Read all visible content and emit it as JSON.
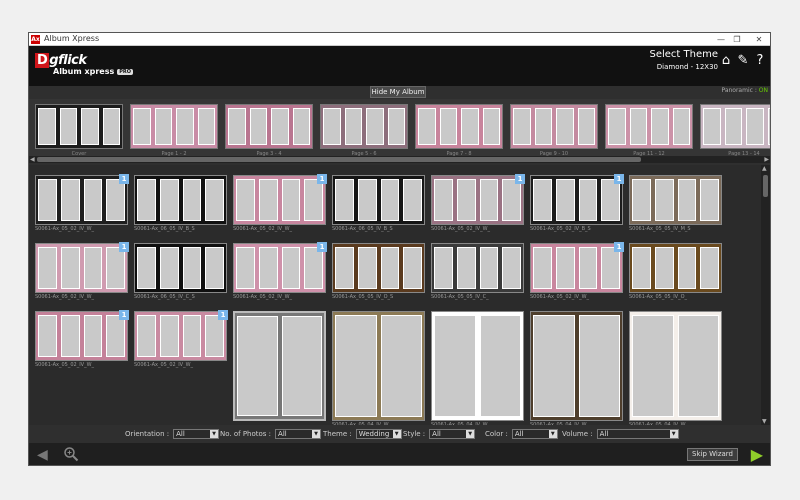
{
  "window": {
    "title": "Album Xpress",
    "app_icon": "Ax",
    "min": "—",
    "max": "❐",
    "close": "✕"
  },
  "header": {
    "brand_d": "D",
    "brand_rest": "gflick",
    "product": "Album xpress",
    "edition": "PRO",
    "select_theme": "Select Theme",
    "album_size": "Diamond - 12X30",
    "icons": [
      "home-icon",
      "wrench-icon",
      "help-icon"
    ]
  },
  "album_bar": {
    "hide_label": "Hide My Album",
    "panoramic_label": "Panoramic :",
    "panoramic_value": "ON"
  },
  "album_spreads": [
    {
      "caption": "Cover",
      "bg": "#1c1c1c"
    },
    {
      "caption": "Page 1 - 2",
      "bg": "#c98ca6"
    },
    {
      "caption": "Page 3 - 4",
      "bg": "#b97590"
    },
    {
      "caption": "Page 5 - 6",
      "bg": "#8d6e7c"
    },
    {
      "caption": "Page 7 - 8",
      "bg": "#c8849c"
    },
    {
      "caption": "Page 9 - 10",
      "bg": "#c48aa0"
    },
    {
      "caption": "Page 11 - 12",
      "bg": "#cc92a8"
    },
    {
      "caption": "Page 13 - 14",
      "bg": "#c9b6c2"
    }
  ],
  "themes": [
    {
      "label": "S0061-Ax_05_02_IV_W_",
      "bg": "#1e1e1e",
      "badge": "1"
    },
    {
      "label": "S0061-Ax_06_05_IV_B_S",
      "bg": "#111111",
      "badge": ""
    },
    {
      "label": "S0061-Ax_05_02_IV_W_",
      "bg": "#c8869f",
      "badge": "1"
    },
    {
      "label": "S0061-Ax_06_05_IV_B_S",
      "bg": "#151515",
      "badge": ""
    },
    {
      "label": "S0061-Ax_05_02_IV_W_",
      "bg": "#9a7283",
      "badge": "1"
    },
    {
      "label": "S0061-Ax_05_02_IV_B_S",
      "bg": "#1b1b1b",
      "badge": "1"
    },
    {
      "label": "S0061-Ax_05_05_IV_M_S",
      "bg": "#7b6a59",
      "badge": ""
    },
    {
      "label": "S0061-Ax_05_02_IV_W_",
      "bg": "#d09bb0",
      "badge": "1"
    },
    {
      "label": "S0061-Ax_06_05_IV_C_S",
      "bg": "#0f0f0f",
      "badge": ""
    },
    {
      "label": "S0061-Ax_05_02_IV_W_",
      "bg": "#cf91aa",
      "badge": "1"
    },
    {
      "label": "S0061-Ax_05_05_IV_O_S",
      "bg": "#5a3a1e",
      "badge": ""
    },
    {
      "label": "S0061-Ax_05_05_IV_C_",
      "bg": "#3a3a3a",
      "badge": ""
    },
    {
      "label": "S0061-Ax_05_02_IV_W_",
      "bg": "#c9869e",
      "badge": "1"
    },
    {
      "label": "S0061-Ax_05_05_IV_O_",
      "bg": "#6a4a1e",
      "badge": ""
    },
    {
      "label": "S0061-Ax_05_02_IV_W_",
      "bg": "#c48199",
      "badge": "1"
    },
    {
      "label": "S0061-Ax_05_02_IV_W_",
      "bg": "#c98aa1",
      "badge": "1"
    },
    {
      "label": "",
      "bg": "#777777",
      "badge": ""
    },
    {
      "label": "S0061-Ax_05_04_IV_W_",
      "bg": "#8c7a55",
      "badge": ""
    },
    {
      "label": "S0061-Ax_05_04_IV_W_",
      "bg": "#ffffff",
      "badge": ""
    },
    {
      "label": "S0061-Ax_05_04_IV_W_",
      "bg": "#4e3e2c",
      "badge": ""
    },
    {
      "label": "S0061-Ax_05_04_IV_W_",
      "bg": "#f4efea",
      "badge": ""
    }
  ],
  "filters": [
    {
      "label": "Orientation :",
      "value": "All"
    },
    {
      "label": "No. of Photos :",
      "value": "All"
    },
    {
      "label": "Theme :",
      "value": "Wedding"
    },
    {
      "label": "Style :",
      "value": "All"
    },
    {
      "label": "Color :",
      "value": "All"
    },
    {
      "label": "Volume :",
      "value": "All"
    }
  ],
  "footer": {
    "skip_label": "Skip Wizard",
    "back_icon": "back-arrow-icon",
    "zoom_icon": "zoom-icon",
    "next_icon": "next-arrow-icon"
  }
}
